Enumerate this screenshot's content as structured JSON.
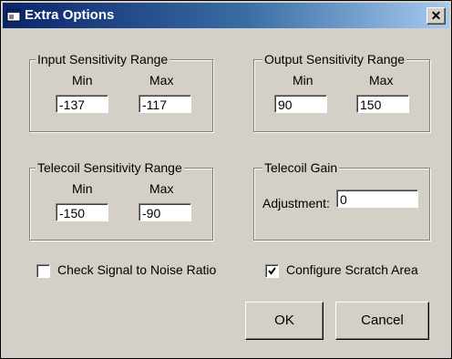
{
  "window": {
    "title": "Extra Options",
    "close_glyph": "✕",
    "icon": "app-icon"
  },
  "input_range": {
    "legend": "Input Sensitivity Range",
    "min_label": "Min",
    "max_label": "Max",
    "min_value": "-137",
    "max_value": "-117"
  },
  "output_range": {
    "legend": "Output Sensitivity Range",
    "min_label": "Min",
    "max_label": "Max",
    "min_value": "90",
    "max_value": "150"
  },
  "telecoil_range": {
    "legend": "Telecoil Sensitivity Range",
    "min_label": "Min",
    "max_label": "Max",
    "min_value": "-150",
    "max_value": "-90"
  },
  "telecoil_gain": {
    "legend": "Telecoil Gain",
    "adjustment_label": "Adjustment:",
    "adjustment_value": "0"
  },
  "options": {
    "snr_label": "Check Signal to Noise Ratio",
    "snr_checked": false,
    "scratch_label": "Configure Scratch Area",
    "scratch_checked": true
  },
  "buttons": {
    "ok": "OK",
    "cancel": "Cancel"
  }
}
